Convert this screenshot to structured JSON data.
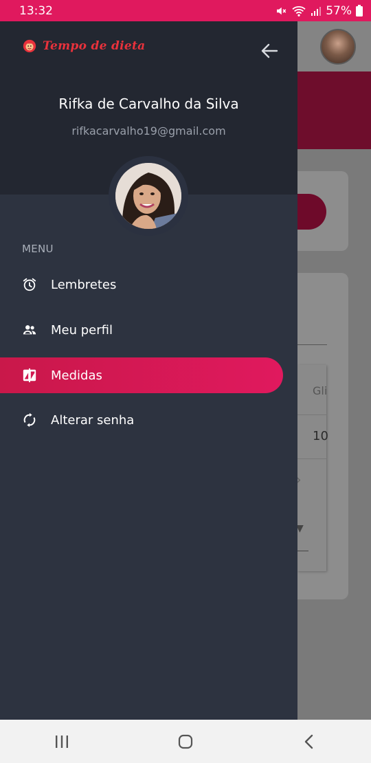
{
  "status_bar": {
    "time": "13:32",
    "battery": "57%"
  },
  "background": {
    "table_header": "Gli",
    "table_value": "10"
  },
  "drawer": {
    "logo_text": "Tempo de dieta",
    "user_name": "Rifka de Carvalho da Silva",
    "user_email": "rifkacarvalho19@gmail.com",
    "menu_label": "MENU",
    "items": [
      {
        "label": "Lembretes",
        "icon": "alarm-icon",
        "active": false
      },
      {
        "label": "Meu perfil",
        "icon": "people-icon",
        "active": false
      },
      {
        "label": "Medidas",
        "icon": "compare-icon",
        "active": true
      },
      {
        "label": "Alterar senha",
        "icon": "sync-icon",
        "active": false
      }
    ]
  },
  "colors": {
    "accent": "#e0195e",
    "drawer_bg": "#2d3340",
    "drawer_header_bg": "#232731",
    "logo": "#e8323c"
  }
}
